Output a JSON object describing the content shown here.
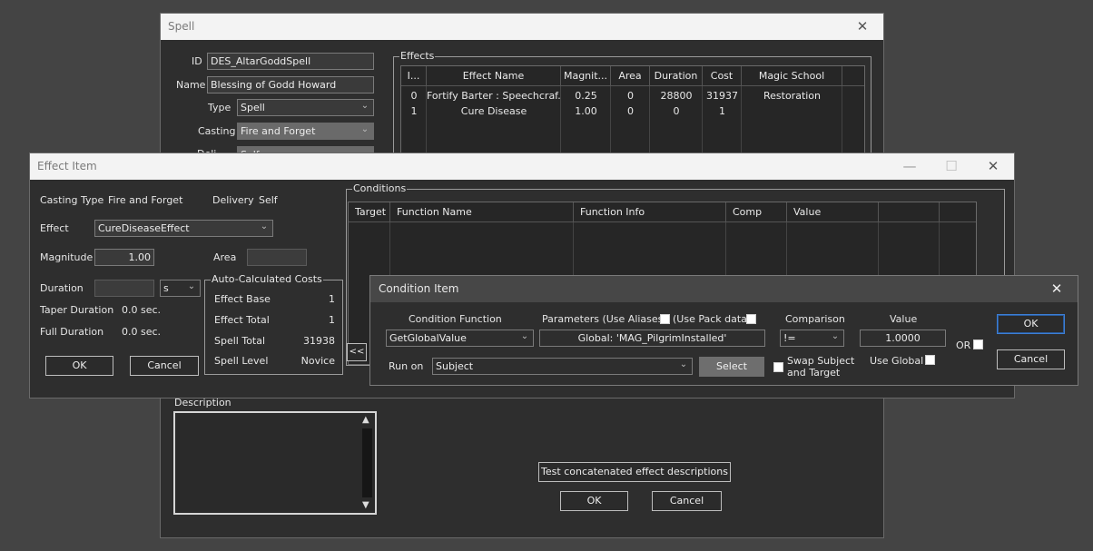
{
  "spell": {
    "title": "Spell",
    "close_icon": "close-icon",
    "id_label": "ID",
    "id_value": "DES_AltarGoddSpell",
    "name_label": "Name",
    "name_value": "Blessing of Godd Howard",
    "type_label": "Type",
    "type_value": "Spell",
    "casting_label": "Casting",
    "casting_value": "Fire and Forget",
    "delivery_label_partial": "Deli...",
    "delivery_value_partial": "Self",
    "effects_group": "Effects",
    "effects_columns": [
      "I...",
      "Effect Name",
      "Magnit...",
      "Area",
      "Duration",
      "Cost",
      "Magic School"
    ],
    "effects_rows": [
      {
        "index": "0",
        "name": "Fortify Barter : Speechcraf...",
        "magnitude": "0.25",
        "area": "0",
        "duration": "28800",
        "cost": "31937",
        "school": "Restoration"
      },
      {
        "index": "1",
        "name": "Cure Disease",
        "magnitude": "1.00",
        "area": "0",
        "duration": "0",
        "cost": "1",
        "school": ""
      }
    ],
    "description_label": "Description",
    "test_button": "Test concatenated effect descriptions",
    "ok_button": "OK",
    "cancel_button": "Cancel"
  },
  "effect_item": {
    "title": "Effect Item",
    "casting_type_label": "Casting Type",
    "casting_type_value": "Fire and Forget",
    "delivery_label": "Delivery",
    "delivery_value": "Self",
    "effect_label": "Effect",
    "effect_value": "CureDiseaseEffect",
    "magnitude_label": "Magnitude",
    "magnitude_value": "1.00",
    "area_label": "Area",
    "area_value": "",
    "duration_label": "Duration",
    "duration_value": "",
    "duration_unit": "s",
    "taper_label": "Taper Duration",
    "taper_value": "0.0 sec.",
    "full_label": "Full Duration",
    "full_value": "0.0 sec.",
    "costs_group": "Auto-Calculated Costs",
    "costs": [
      {
        "label": "Effect Base",
        "value": "1"
      },
      {
        "label": "Effect Total",
        "value": "1"
      },
      {
        "label": "Spell Total",
        "value": "31938"
      },
      {
        "label": "Spell Level",
        "value": "Novice"
      }
    ],
    "ok_button": "OK",
    "cancel_button": "Cancel",
    "conditions_group": "Conditions",
    "conditions_columns": [
      "Target",
      "Function Name",
      "Function Info",
      "Comp",
      "Value",
      "",
      ""
    ],
    "collapse_button": "<<"
  },
  "condition_item": {
    "title": "Condition Item",
    "function_label": "Condition Function",
    "function_value": "GetGlobalValue",
    "parameters_label": "Parameters  (Use Aliases)",
    "use_pack_label": "(Use Pack data)",
    "parameter_value": "Global: 'MAG_PilgrimInstalled'",
    "comparison_label": "Comparison",
    "comparison_value": "!=",
    "value_label": "Value",
    "value_value": "1.0000",
    "or_label": "OR",
    "run_on_label": "Run on",
    "run_on_value": "Subject",
    "select_button": "Select",
    "swap_label_1": "Swap Subject",
    "swap_label_2": "and Target",
    "use_global_label": "Use Global",
    "ok_button": "OK",
    "cancel_button": "Cancel"
  }
}
